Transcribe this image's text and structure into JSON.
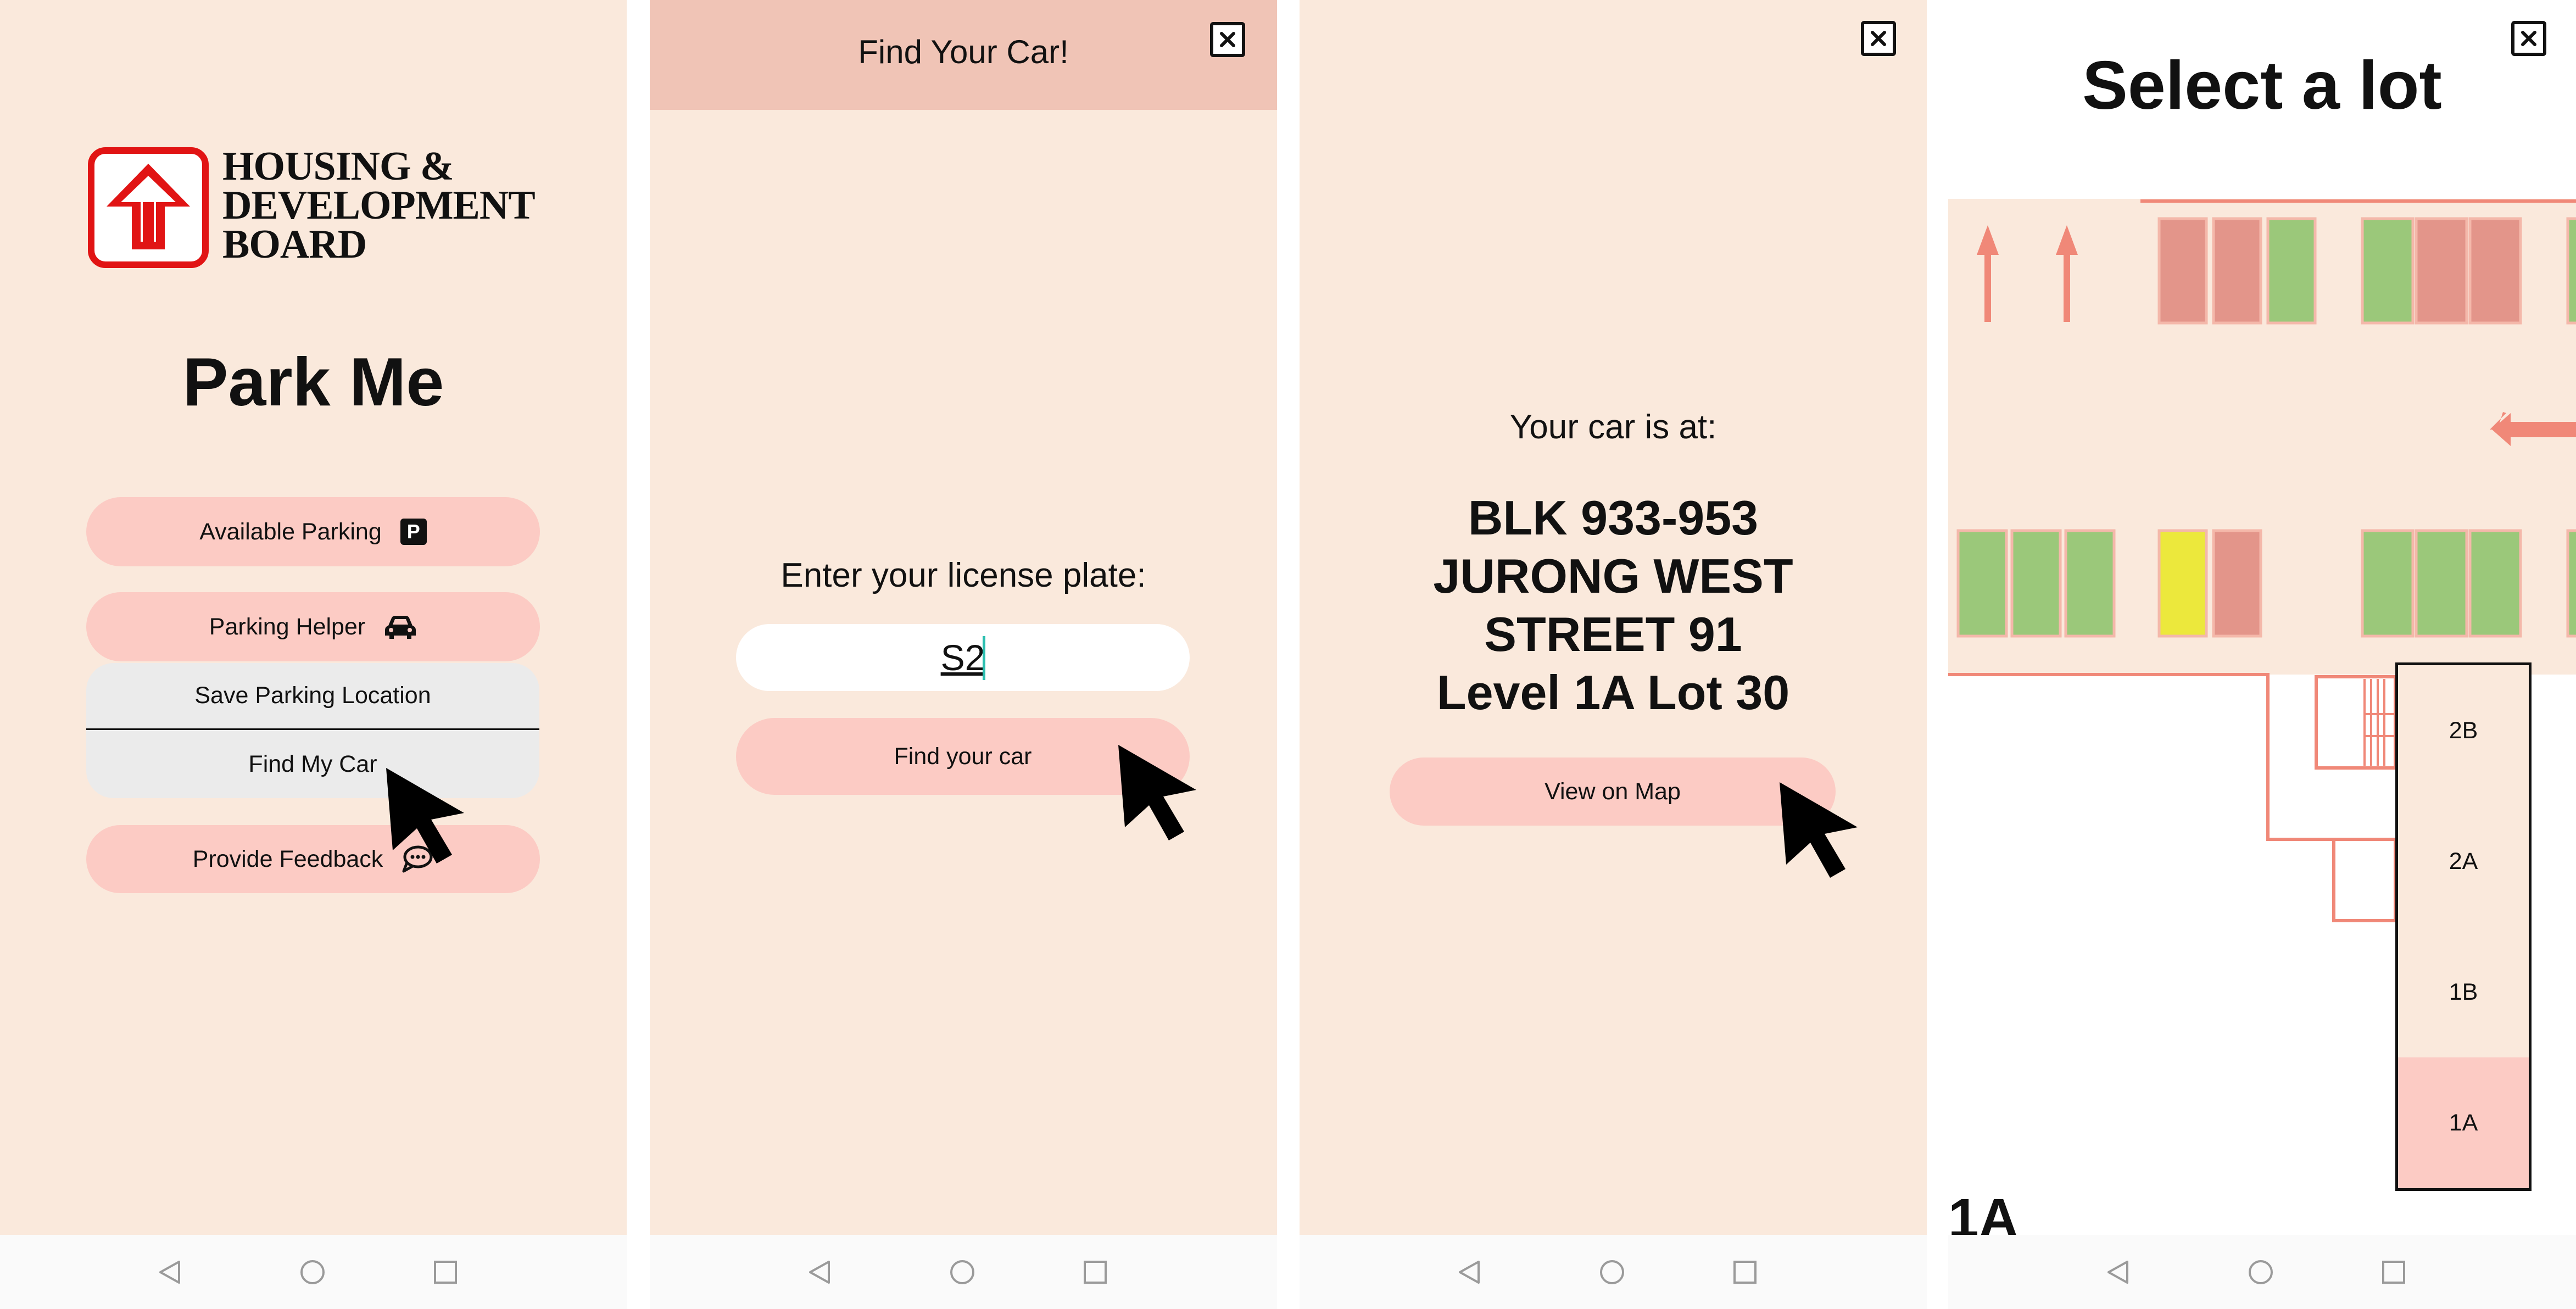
{
  "screen1": {
    "logo_line1": "HOUSING &",
    "logo_line2": "DEVELOPMENT",
    "logo_line3": "BOARD",
    "title": "Park Me",
    "menu": {
      "available_parking": "Available Parking",
      "available_parking_icon": "P",
      "parking_helper": "Parking Helper",
      "save_location": "Save Parking Location",
      "find_my_car": "Find My Car",
      "provide_feedback": "Provide Feedback"
    }
  },
  "screen2": {
    "header_title": "Find Your Car!",
    "prompt": "Enter your license plate:",
    "plate_value": "S2",
    "find_button": "Find your car"
  },
  "screen3": {
    "label": "Your car is at:",
    "address_line1": "BLK 933-953",
    "address_line2": "JURONG WEST",
    "address_line3": "STREET 91",
    "address_line4": "Level 1A Lot 30",
    "map_button": "View on Map"
  },
  "screen4": {
    "title": "Select a lot",
    "floors": [
      "2B",
      "2A",
      "1B",
      "1A"
    ],
    "selected_floor": "1A",
    "current_floor_label": "1A"
  },
  "colors": {
    "background": "#fae9dc",
    "button": "#fccbc4",
    "header": "#f0c4b6",
    "lot_available": "#9bc87a",
    "lot_occupied": "#e3958a",
    "lot_reserved": "#ece83c",
    "wall": "#f08878"
  }
}
